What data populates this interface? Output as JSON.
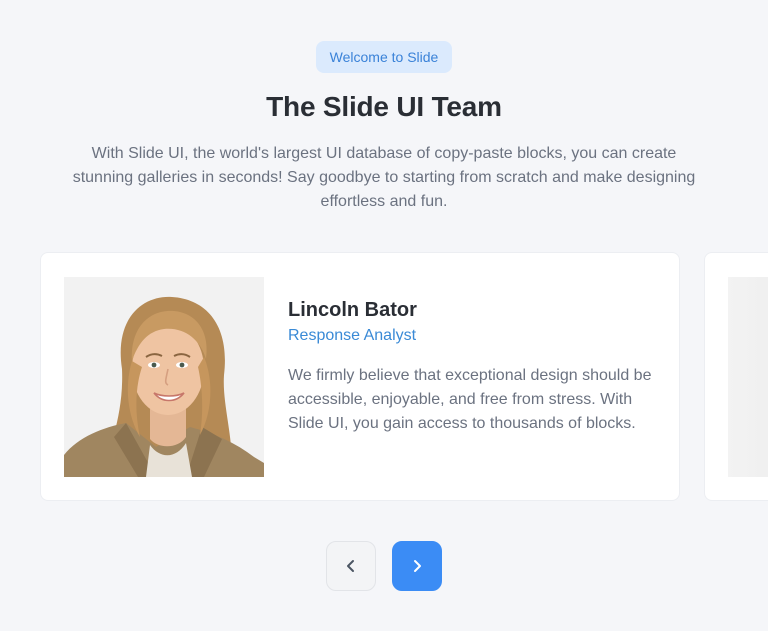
{
  "header": {
    "badge": "Welcome to Slide",
    "title": "The Slide UI Team",
    "description": "With Slide UI, the world's largest UI database of copy-paste blocks, you can create stunning galleries in seconds! Say goodbye to starting from scratch and make designing effortless and fun."
  },
  "members": [
    {
      "name": "Lincoln Bator",
      "role": "Response Analyst",
      "quote": "We firmly believe that exceptional design should be accessible, enjoyable, and free from stress. With Slide UI, you gain access to thousands of blocks.",
      "photo_icon": "portrait-photo"
    }
  ],
  "controls": {
    "prev_icon": "chevron-left-icon",
    "next_icon": "chevron-right-icon"
  },
  "colors": {
    "background": "#f5f6f9",
    "accent": "#3b8cf5",
    "badge_bg": "#dbeafd",
    "badge_text": "#3a82d8",
    "role_text": "#3a8ad6"
  }
}
